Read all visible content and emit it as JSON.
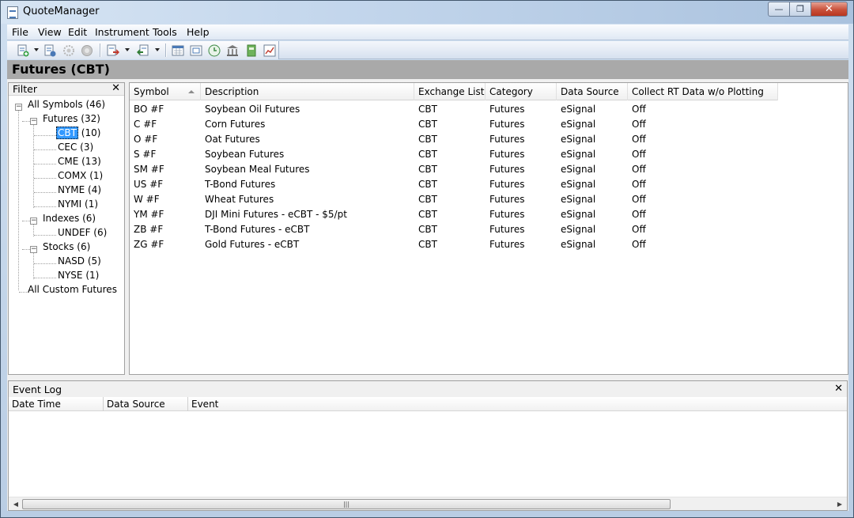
{
  "window": {
    "title": "QuoteManager",
    "min_label": "—",
    "max_label": "❐",
    "close_label": "✕"
  },
  "menu": [
    "File",
    "View",
    "Edit",
    "Instrument",
    "Tools",
    "Help"
  ],
  "toolbar": {
    "icons": [
      "add-symbol-icon",
      "edit-symbol-icon",
      "settings-icon",
      "disconnect-icon",
      "export-icon",
      "import-icon",
      "calendar-icon",
      "session-icon",
      "clock-icon",
      "exchange-icon",
      "book-icon",
      "chart-icon"
    ]
  },
  "panel_title": "Futures (CBT)",
  "filter": {
    "title": "Filter",
    "close": "✕",
    "tree": {
      "all_symbols": "All Symbols (46)",
      "futures": "Futures (32)",
      "cbt": "CBT",
      "cbt_count": "(10)",
      "cec": "CEC (3)",
      "cme": "CME (13)",
      "comx": "COMX (1)",
      "nyme": "NYME (4)",
      "nymi": "NYMI (1)",
      "indexes": "Indexes (6)",
      "undef": "UNDEF (6)",
      "stocks": "Stocks (6)",
      "nasd": "NASD (5)",
      "nyse": "NYSE (1)",
      "all_custom": "All Custom Futures",
      "toggle": "−"
    }
  },
  "grid": {
    "columns": [
      "Symbol",
      "Description",
      "Exchange List...",
      "Category",
      "Data Source",
      "Collect RT Data w/o Plotting"
    ],
    "rows": [
      [
        "BO #F",
        "Soybean Oil Futures",
        "CBT",
        "Futures",
        "eSignal",
        "Off"
      ],
      [
        "C #F",
        "Corn Futures",
        "CBT",
        "Futures",
        "eSignal",
        "Off"
      ],
      [
        "O #F",
        "Oat Futures",
        "CBT",
        "Futures",
        "eSignal",
        "Off"
      ],
      [
        "S #F",
        "Soybean Futures",
        "CBT",
        "Futures",
        "eSignal",
        "Off"
      ],
      [
        "SM #F",
        "Soybean Meal Futures",
        "CBT",
        "Futures",
        "eSignal",
        "Off"
      ],
      [
        "US #F",
        "T-Bond Futures",
        "CBT",
        "Futures",
        "eSignal",
        "Off"
      ],
      [
        "W #F",
        "Wheat Futures",
        "CBT",
        "Futures",
        "eSignal",
        "Off"
      ],
      [
        "YM #F",
        "DJI Mini Futures - eCBT - $5/pt",
        "CBT",
        "Futures",
        "eSignal",
        "Off"
      ],
      [
        "ZB #F",
        "T-Bond Futures - eCBT",
        "CBT",
        "Futures",
        "eSignal",
        "Off"
      ],
      [
        "ZG #F",
        "Gold Futures - eCBT",
        "CBT",
        "Futures",
        "eSignal",
        "Off"
      ]
    ]
  },
  "event_log": {
    "title": "Event Log",
    "close": "✕",
    "columns": [
      "Date Time",
      "Data Source",
      "Event"
    ],
    "scroll_grip": "|||",
    "scroll_left": "◀",
    "scroll_right": "▶"
  }
}
